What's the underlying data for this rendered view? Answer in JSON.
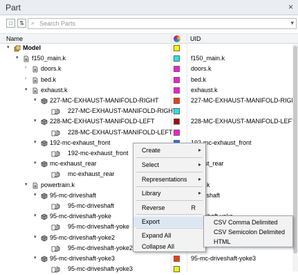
{
  "panel": {
    "title": "Part",
    "close": "×"
  },
  "toolbar": {
    "search_placeholder": "Search Parts",
    "search_dropdown": "▾",
    "btn1": "□",
    "btn2": "⇅"
  },
  "columns": {
    "name": "Name",
    "uid": "UID"
  },
  "tree": [
    {
      "depth": 0,
      "expander": "▾",
      "icon": "model",
      "label": "Model",
      "bold": true,
      "color": "#ffff00",
      "uid": ""
    },
    {
      "depth": 1,
      "expander": "▾",
      "icon": "file",
      "label": "f150_main.k",
      "color": "#33dde0",
      "uid": "f150_main.k"
    },
    {
      "depth": 2,
      "expander": "›",
      "icon": "file",
      "label": "doors.k",
      "color": "#ee22cc",
      "uid": "doors.k"
    },
    {
      "depth": 2,
      "expander": "›",
      "icon": "file",
      "label": "bed.k",
      "color": "#ee22cc",
      "uid": "bed.k"
    },
    {
      "depth": 2,
      "expander": "▾",
      "icon": "file",
      "label": "exhaust.k",
      "color": "#ee22cc",
      "uid": "exhaust.k"
    },
    {
      "depth": 3,
      "expander": "▾",
      "icon": "part",
      "label": "227-MC-EXHAUST-MANIFOLD-RIGHT",
      "color": "#e8401c",
      "uid": "227-MC-EXHAUST-MANIFOLD-RIGH"
    },
    {
      "depth": 4,
      "expander": "",
      "icon": "comp",
      "label": "227-MC-EXHAUST-MANIFOLD-RIGHT",
      "color": "#33dde0",
      "uid": ""
    },
    {
      "depth": 3,
      "expander": "▾",
      "icon": "part",
      "label": "228-MC-EXHAUST-MANIFOLD-LEFT",
      "color": "#9a0f0f",
      "uid": "228-MC-EXHAUST-MANIFOLD-LEFT"
    },
    {
      "depth": 4,
      "expander": "",
      "icon": "comp",
      "label": "228-MC-EXHAUST-MANIFOLD-LEFT",
      "color": "#ee22cc",
      "uid": ""
    },
    {
      "depth": 3,
      "expander": "▾",
      "icon": "part",
      "label": "192-mc-exhaust_front",
      "color": "#2a6fdc",
      "uid": "192-mc-exhaust_front"
    },
    {
      "depth": 4,
      "expander": "",
      "icon": "comp",
      "label": "192-mc-exhaust_front",
      "color": "",
      "uid": ""
    },
    {
      "depth": 3,
      "expander": "▾",
      "icon": "part",
      "label": "mc-exhaust_rear",
      "color": "",
      "uid": "chaust_rear"
    },
    {
      "depth": 4,
      "expander": "",
      "icon": "comp",
      "label": "mc-exhaust_rear",
      "color": "",
      "uid": ""
    },
    {
      "depth": 2,
      "expander": "▾",
      "icon": "file",
      "label": "powertrain.k",
      "color": "",
      "uid": "rtrain.k"
    },
    {
      "depth": 3,
      "expander": "▾",
      "icon": "part",
      "label": "95-mc-driveshaft",
      "color": "",
      "uid": "-driveshaft"
    },
    {
      "depth": 4,
      "expander": "",
      "icon": "comp",
      "label": "95-mc-driveshaft",
      "color": "",
      "uid": ""
    },
    {
      "depth": 3,
      "expander": "▾",
      "icon": "part",
      "label": "95-mc-driveshaft-yoke",
      "color": "",
      "uid": "driveshaft-yoke"
    },
    {
      "depth": 4,
      "expander": "",
      "icon": "comp",
      "label": "95-mc-driveshaft-yoke",
      "color": "",
      "uid": ""
    },
    {
      "depth": 3,
      "expander": "▾",
      "icon": "part",
      "label": "95-mc-driveshaft-yoke2",
      "color": "",
      "uid": "driveshaft-yoke2"
    },
    {
      "depth": 4,
      "expander": "",
      "icon": "comp",
      "label": "95-mc-driveshaft-yoke2",
      "color": "",
      "uid": ""
    },
    {
      "depth": 3,
      "expander": "▾",
      "icon": "part",
      "label": "95-mc-driveshaft-yoke3",
      "color": "#e8401c",
      "uid": "95-mc-driveshaft-yoke3"
    },
    {
      "depth": 4,
      "expander": "",
      "icon": "comp",
      "label": "95-mc-driveshaft-yoke3",
      "color": "#e6f020",
      "uid": ""
    }
  ],
  "context_menu": {
    "items": [
      {
        "label": "Create",
        "arrow": "▸",
        "key": ""
      },
      {
        "label": "Select",
        "arrow": "▸",
        "key": ""
      },
      {
        "label": "Representations",
        "arrow": "▸",
        "key": ""
      },
      {
        "label": "Library",
        "arrow": "▸",
        "key": ""
      },
      {
        "label": "Reverse",
        "arrow": "",
        "key": "R"
      },
      {
        "label": "Export",
        "arrow": "",
        "key": ""
      },
      {
        "label": "Expand All",
        "arrow": "",
        "key": ""
      },
      {
        "label": "Collapse All",
        "arrow": "",
        "key": ""
      }
    ]
  },
  "export_submenu": {
    "items": [
      "CSV Comma Delimited",
      "CSV Semicolon Delimited",
      "HTML"
    ]
  }
}
